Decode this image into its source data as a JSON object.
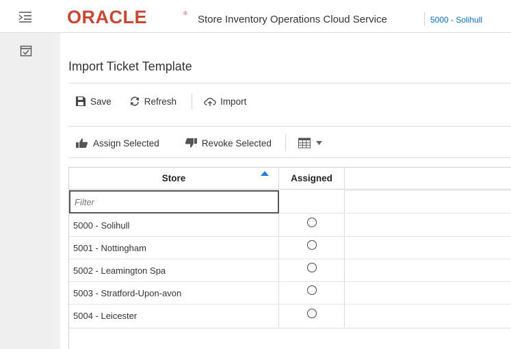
{
  "header": {
    "logo_text": "ORACLE",
    "logo_mark": "®",
    "app_title": "Store Inventory Operations Cloud Service",
    "store_selector": "5000 - Solihull",
    "brand_color": "#c74634"
  },
  "rail": {
    "menu_icon": "hamburger-menu-icon",
    "tasks_icon": "calendar-check-icon"
  },
  "page": {
    "title": "Import Ticket Template"
  },
  "toolbar_primary": {
    "save_label": "Save",
    "refresh_label": "Refresh",
    "import_label": "Import"
  },
  "toolbar_secondary": {
    "assign_label": "Assign Selected",
    "revoke_label": "Revoke Selected"
  },
  "table": {
    "columns": {
      "store": "Store",
      "assigned": "Assigned"
    },
    "filter_placeholder": "Filter",
    "sort_column": "Store",
    "sort_direction": "ascending",
    "rows": [
      {
        "store": "5000 - Solihull",
        "assigned": false
      },
      {
        "store": "5001 - Nottingham",
        "assigned": false
      },
      {
        "store": "5002 - Leamington Spa",
        "assigned": false
      },
      {
        "store": "5003 - Stratford-Upon-avon",
        "assigned": false
      },
      {
        "store": "5004 - Leicester",
        "assigned": false
      }
    ]
  },
  "colors": {
    "link": "#0a6ebd",
    "sort_indicator": "#1f7ed6"
  }
}
